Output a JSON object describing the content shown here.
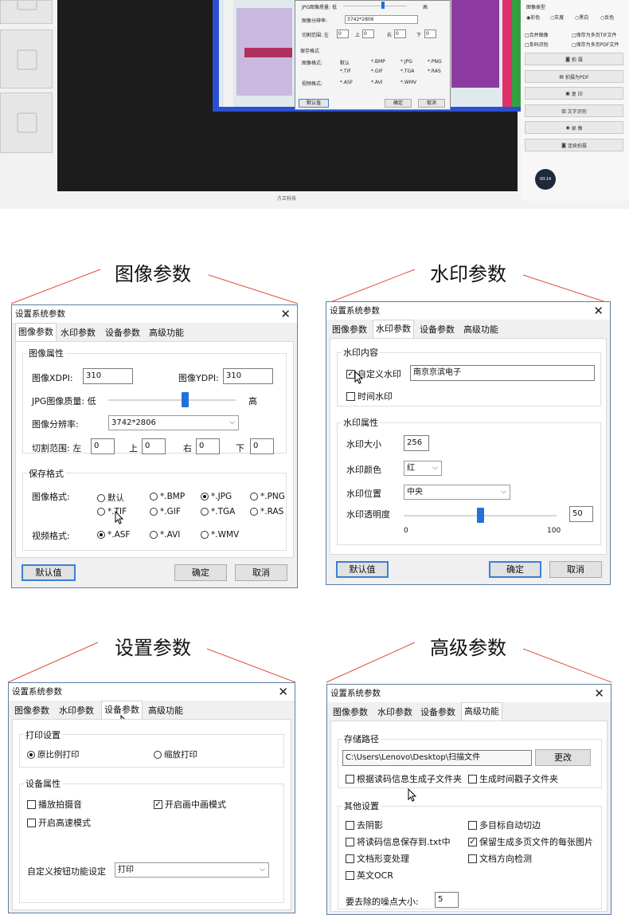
{
  "top_preview": {
    "mini_dialog": {
      "jpg_quality_label": "JPG图像质量: 低",
      "jpg_quality_high": "高",
      "resolution_label": "图像分辨率:",
      "resolution_value": "3742*2806",
      "crop_label": "切割范围: 左",
      "crop_left": "0",
      "crop_top_label": "上",
      "crop_top": "0",
      "crop_right_label": "右",
      "crop_right": "0",
      "crop_bottom_label": "下",
      "crop_bottom": "0",
      "save_format_title": "保存格式",
      "image_format_label": "图像格式:",
      "image_formats": [
        "默认",
        "*.BMP",
        "*.JPG",
        "*.PNG",
        "*.TIF",
        "*.GIF",
        "*.TGA",
        "*.RAS"
      ],
      "video_format_label": "视频格式:",
      "video_formats": [
        "*.ASF",
        "*.AVI",
        "*.WMV"
      ],
      "default_button": "默认值",
      "ok_button": "确定",
      "cancel_button": "取消"
    },
    "right_panel": {
      "image_type_label": "图像类型",
      "color_modes": [
        "彩色",
        "灰度",
        "黑白",
        "反色"
      ],
      "options": [
        "合并图像",
        "保存为多页TIF文件",
        "条码识别",
        "保存为多页PDF文件"
      ],
      "buttons": [
        "拍 摄",
        "拍摄为PDF",
        "复 印",
        "文字识别",
        "录 像",
        "连续拍摄"
      ],
      "timer": "00:14"
    },
    "brand": "方正科技"
  },
  "headings": {
    "image_params": "图像参数",
    "watermark_params": "水印参数",
    "device_params": "设置参数",
    "advanced_params": "高级参数"
  },
  "tabs": [
    "图像参数",
    "水印参数",
    "设备参数",
    "高级功能"
  ],
  "dialog_title": "设置系统参数",
  "close_glyph": "✕",
  "image_dialog": {
    "image_props_title": "图像属性",
    "xdpi_label": "图像XDPI:",
    "xdpi_value": "310",
    "ydpi_label": "图像YDPI:",
    "ydpi_value": "310",
    "jpg_quality_label": "JPG图像质量: 低",
    "jpg_quality_high": "高",
    "jpg_quality_level": 0.6,
    "resolution_label": "图像分辨率:",
    "resolution_value": "3742*2806",
    "crop_label": "切割范围: 左",
    "crop_left": "0",
    "crop_top_label": "上",
    "crop_top": "0",
    "crop_right_label": "右",
    "crop_right": "0",
    "crop_bottom_label": "下",
    "crop_bottom": "0",
    "save_format_title": "保存格式",
    "image_format_label": "图像格式:",
    "image_formats": [
      "默认",
      "*.BMP",
      "*.JPG",
      "*.PNG",
      "*.TIF",
      "*.GIF",
      "*.TGA",
      "*.RAS"
    ],
    "video_format_label": "视频格式:",
    "video_formats": [
      "*.ASF",
      "*.AVI",
      "*.WMV"
    ],
    "default_button": "默认值",
    "ok_button": "确定",
    "cancel_button": "取消"
  },
  "watermark_dialog": {
    "content_title": "水印内容",
    "custom_label": "自定义水印",
    "custom_value": "南京京滨电子",
    "time_label": "时间水印",
    "props_title": "水印属性",
    "size_label": "水印大小",
    "size_value": "256",
    "color_label": "水印颜色",
    "color_value": "红",
    "position_label": "水印位置",
    "position_value": "中央",
    "opacity_label": "水印透明度",
    "opacity_value": "50",
    "opacity_min": "0",
    "opacity_max": "100",
    "default_button": "默认值",
    "ok_button": "确定",
    "cancel_button": "取消"
  },
  "device_dialog": {
    "print_title": "打印设置",
    "print_original": "原比例打印",
    "print_scaled": "缩放打印",
    "device_title": "设备属性",
    "shutter_sound": "播放拍摄音",
    "pip_mode": "开启画中画模式",
    "high_speed": "开启高速模式",
    "custom_key_label": "自定义按钮功能设定",
    "custom_key_value": "打印"
  },
  "advanced_dialog": {
    "storage_title": "存储路径",
    "storage_path": "C:\\Users\\Lenovo\\Desktop\\扫描文件",
    "change_button": "更改",
    "barcode_subfolder": "根据读码信息生成子文件夹",
    "time_subfolder": "生成时间戳子文件夹",
    "other_title": "其他设置",
    "options": [
      "去阴影",
      "多目标自动切边",
      "将读码信息保存到.txt中",
      "保留生成多页文件的每张图片",
      "文档形变处理",
      "文档方向检测",
      "英文OCR"
    ],
    "noise_label": "要去除的噪点大小:",
    "noise_value": "5"
  },
  "colors": {
    "accent": "#3c7fd6",
    "slider": "#1f73d8",
    "leader_line": "#e0523a"
  }
}
